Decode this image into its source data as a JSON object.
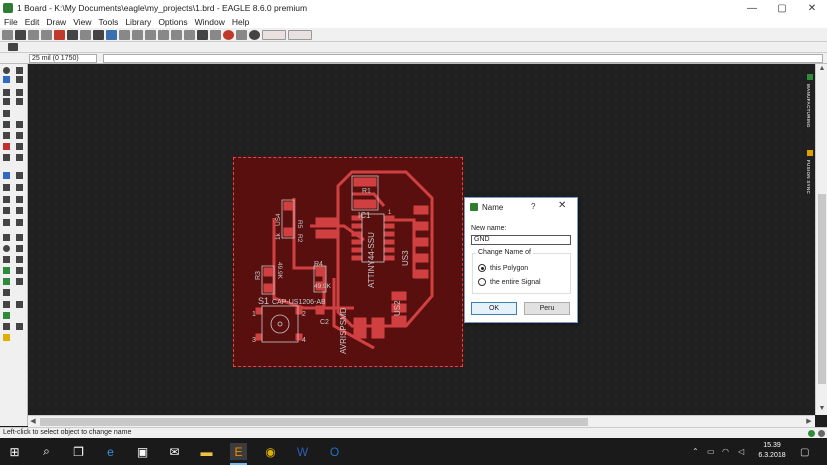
{
  "window": {
    "title": "1 Board - K:\\My Documents\\eagle\\my_projects\\1.brd - EAGLE 8.6.0 premium",
    "minimize": "—",
    "maximize": "▢",
    "close": "✕"
  },
  "menu": {
    "items": [
      "File",
      "Edit",
      "Draw",
      "View",
      "Tools",
      "Library",
      "Options",
      "Window",
      "Help"
    ]
  },
  "command_bar": {
    "coordinate": "25 mil (0 1750)",
    "command_value": ""
  },
  "right_panel": {
    "manufacturing_label": "MANUFACTURING",
    "fusion_sync_label": "FUSION SYNC"
  },
  "board": {
    "labels": [
      "R1",
      "IC1",
      "1",
      "US4",
      "R5",
      "1k",
      "R2",
      "R4",
      "49.9K",
      "R3",
      "49.9K",
      "S1",
      "CAP-US1206-AB",
      "C2",
      "AVRISPSMD",
      "ATTINY44-SSU",
      "US2",
      "US3",
      "1",
      "2",
      "3",
      "4"
    ]
  },
  "dialog": {
    "title": "Name",
    "help": "?",
    "close": "✕",
    "new_name_label": "New name:",
    "new_name_value": "GND",
    "group_title": "Change Name of",
    "option_polygon": "this Polygon",
    "option_signal": "the entire Signal",
    "selected_option": "this Polygon",
    "ok_label": "OK",
    "cancel_label": "Peru"
  },
  "status": {
    "message": "Left-click to select object to change name"
  },
  "taskbar": {
    "time": "15.39",
    "date": "6.3.2018"
  },
  "colors": {
    "board_fill": "#5a0f0f",
    "trace": "#d04040",
    "outline": "#ff3a3a",
    "silk": "#c8c8c8"
  }
}
